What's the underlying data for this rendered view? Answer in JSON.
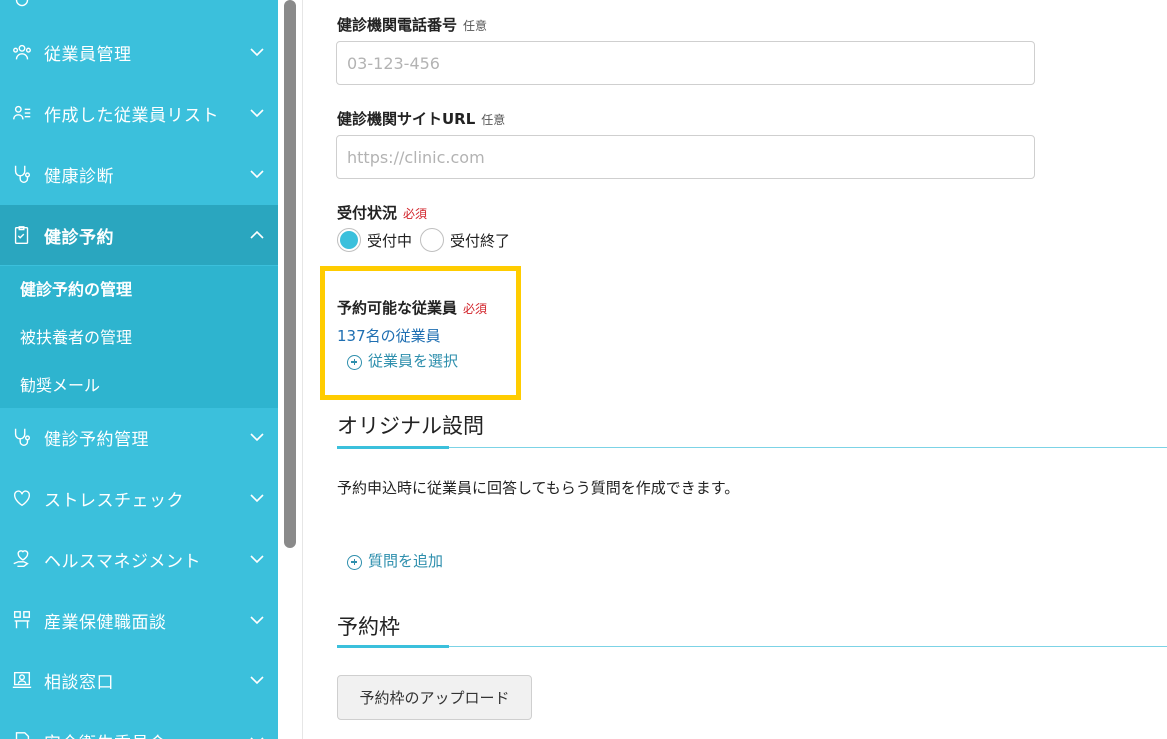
{
  "sidebar": {
    "items": [
      {
        "label": "従業員管理",
        "icon": "people-icon"
      },
      {
        "label": "作成した従業員リスト",
        "icon": "person-list-icon"
      },
      {
        "label": "健康診断",
        "icon": "stethoscope-icon"
      },
      {
        "label": "健診予約",
        "icon": "clipboard-check-icon"
      },
      {
        "label": "健診予約管理",
        "icon": "stethoscope-icon"
      },
      {
        "label": "ストレスチェック",
        "icon": "heart-icon"
      },
      {
        "label": "ヘルスマネジメント",
        "icon": "hand-heart-icon"
      },
      {
        "label": "産業保健職面談",
        "icon": "meeting-icon"
      },
      {
        "label": "相談窓口",
        "icon": "consultation-icon"
      },
      {
        "label": "安全衛生委員会",
        "icon": "document-icon"
      }
    ],
    "submenu": [
      {
        "label": "健診予約の管理"
      },
      {
        "label": "被扶養者の管理"
      },
      {
        "label": "勧奨メール"
      }
    ]
  },
  "form": {
    "phone": {
      "label": "健診機関電話番号",
      "badge": "任意",
      "placeholder": "03-123-456"
    },
    "url": {
      "label": "健診機関サイトURL",
      "badge": "任意",
      "placeholder": "https://clinic.com"
    },
    "status": {
      "label": "受付状況",
      "badge": "必須",
      "options": [
        "受付中",
        "受付終了"
      ],
      "selected": "受付中"
    },
    "employees": {
      "label": "予約可能な従業員",
      "badge": "必須",
      "count_text": "137名の従業員",
      "select_label": "従業員を選択"
    }
  },
  "original_questions": {
    "title": "オリジナル設問",
    "description": "予約申込時に従業員に回答してもらう質問を作成できます。",
    "add_label": "質問を追加"
  },
  "slots": {
    "title": "予約枠",
    "upload_label": "予約枠のアップロード"
  },
  "colors": {
    "sidebar": "#3bc0dc",
    "highlight": "#ffcc00",
    "required": "#d2232a",
    "link": "#1f6fb2"
  }
}
